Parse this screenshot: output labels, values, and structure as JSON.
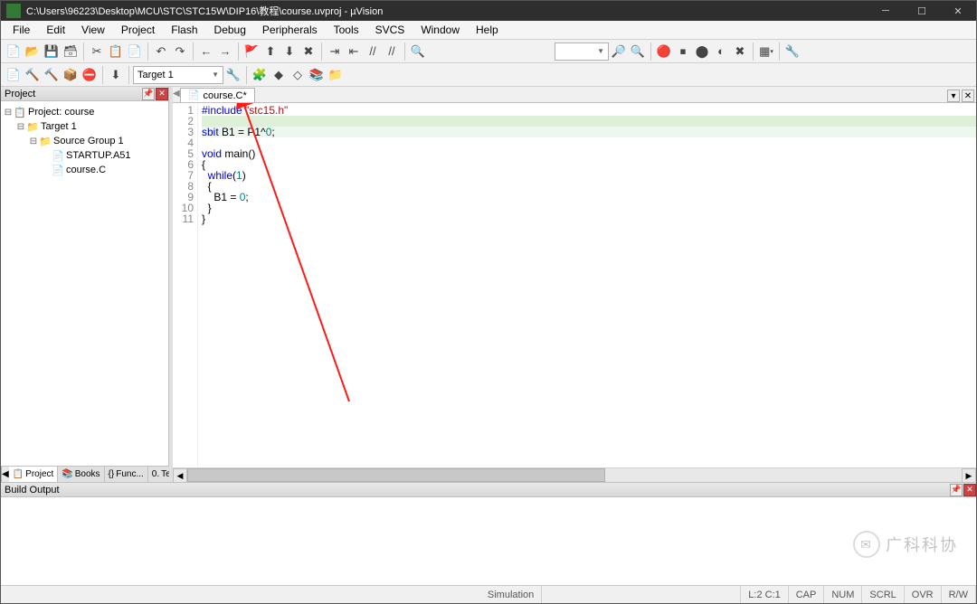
{
  "window_title": "C:\\Users\\96223\\Desktop\\MCU\\STC\\STC15W\\DIP16\\教程\\course.uvproj - µVision",
  "menus": [
    "File",
    "Edit",
    "View",
    "Project",
    "Flash",
    "Debug",
    "Peripherals",
    "Tools",
    "SVCS",
    "Window",
    "Help"
  ],
  "toolbar2": {
    "target": "Target 1"
  },
  "project_panel": {
    "title": "Project",
    "root": "Project: course",
    "target": "Target 1",
    "group": "Source Group 1",
    "files": [
      "STARTUP.A51",
      "course.C"
    ],
    "tabs": [
      "Project",
      "Books",
      "Func...",
      "Temp..."
    ]
  },
  "editor": {
    "tab": "course.C*",
    "lines": [
      {
        "n": 1,
        "pre": "#include ",
        "str": "\"stc15.h\""
      },
      {
        "n": 2,
        "pre": ""
      },
      {
        "n": 3,
        "pre": "sbit B1 = P1^0;"
      },
      {
        "n": 4,
        "pre": ""
      },
      {
        "n": 5,
        "pre": "void main()"
      },
      {
        "n": 6,
        "pre": "{"
      },
      {
        "n": 7,
        "pre": "  while(1)"
      },
      {
        "n": 8,
        "pre": "  {"
      },
      {
        "n": 9,
        "pre": "    B1 = 0;"
      },
      {
        "n": 10,
        "pre": "  }"
      },
      {
        "n": 11,
        "pre": "}"
      }
    ]
  },
  "build_panel": {
    "title": "Build Output"
  },
  "statusbar": {
    "sim": "Simulation",
    "pos": "L:2 C:1",
    "flags": [
      "CAP",
      "NUM",
      "SCRL",
      "OVR",
      "R/W"
    ]
  },
  "watermark": "广科科协"
}
